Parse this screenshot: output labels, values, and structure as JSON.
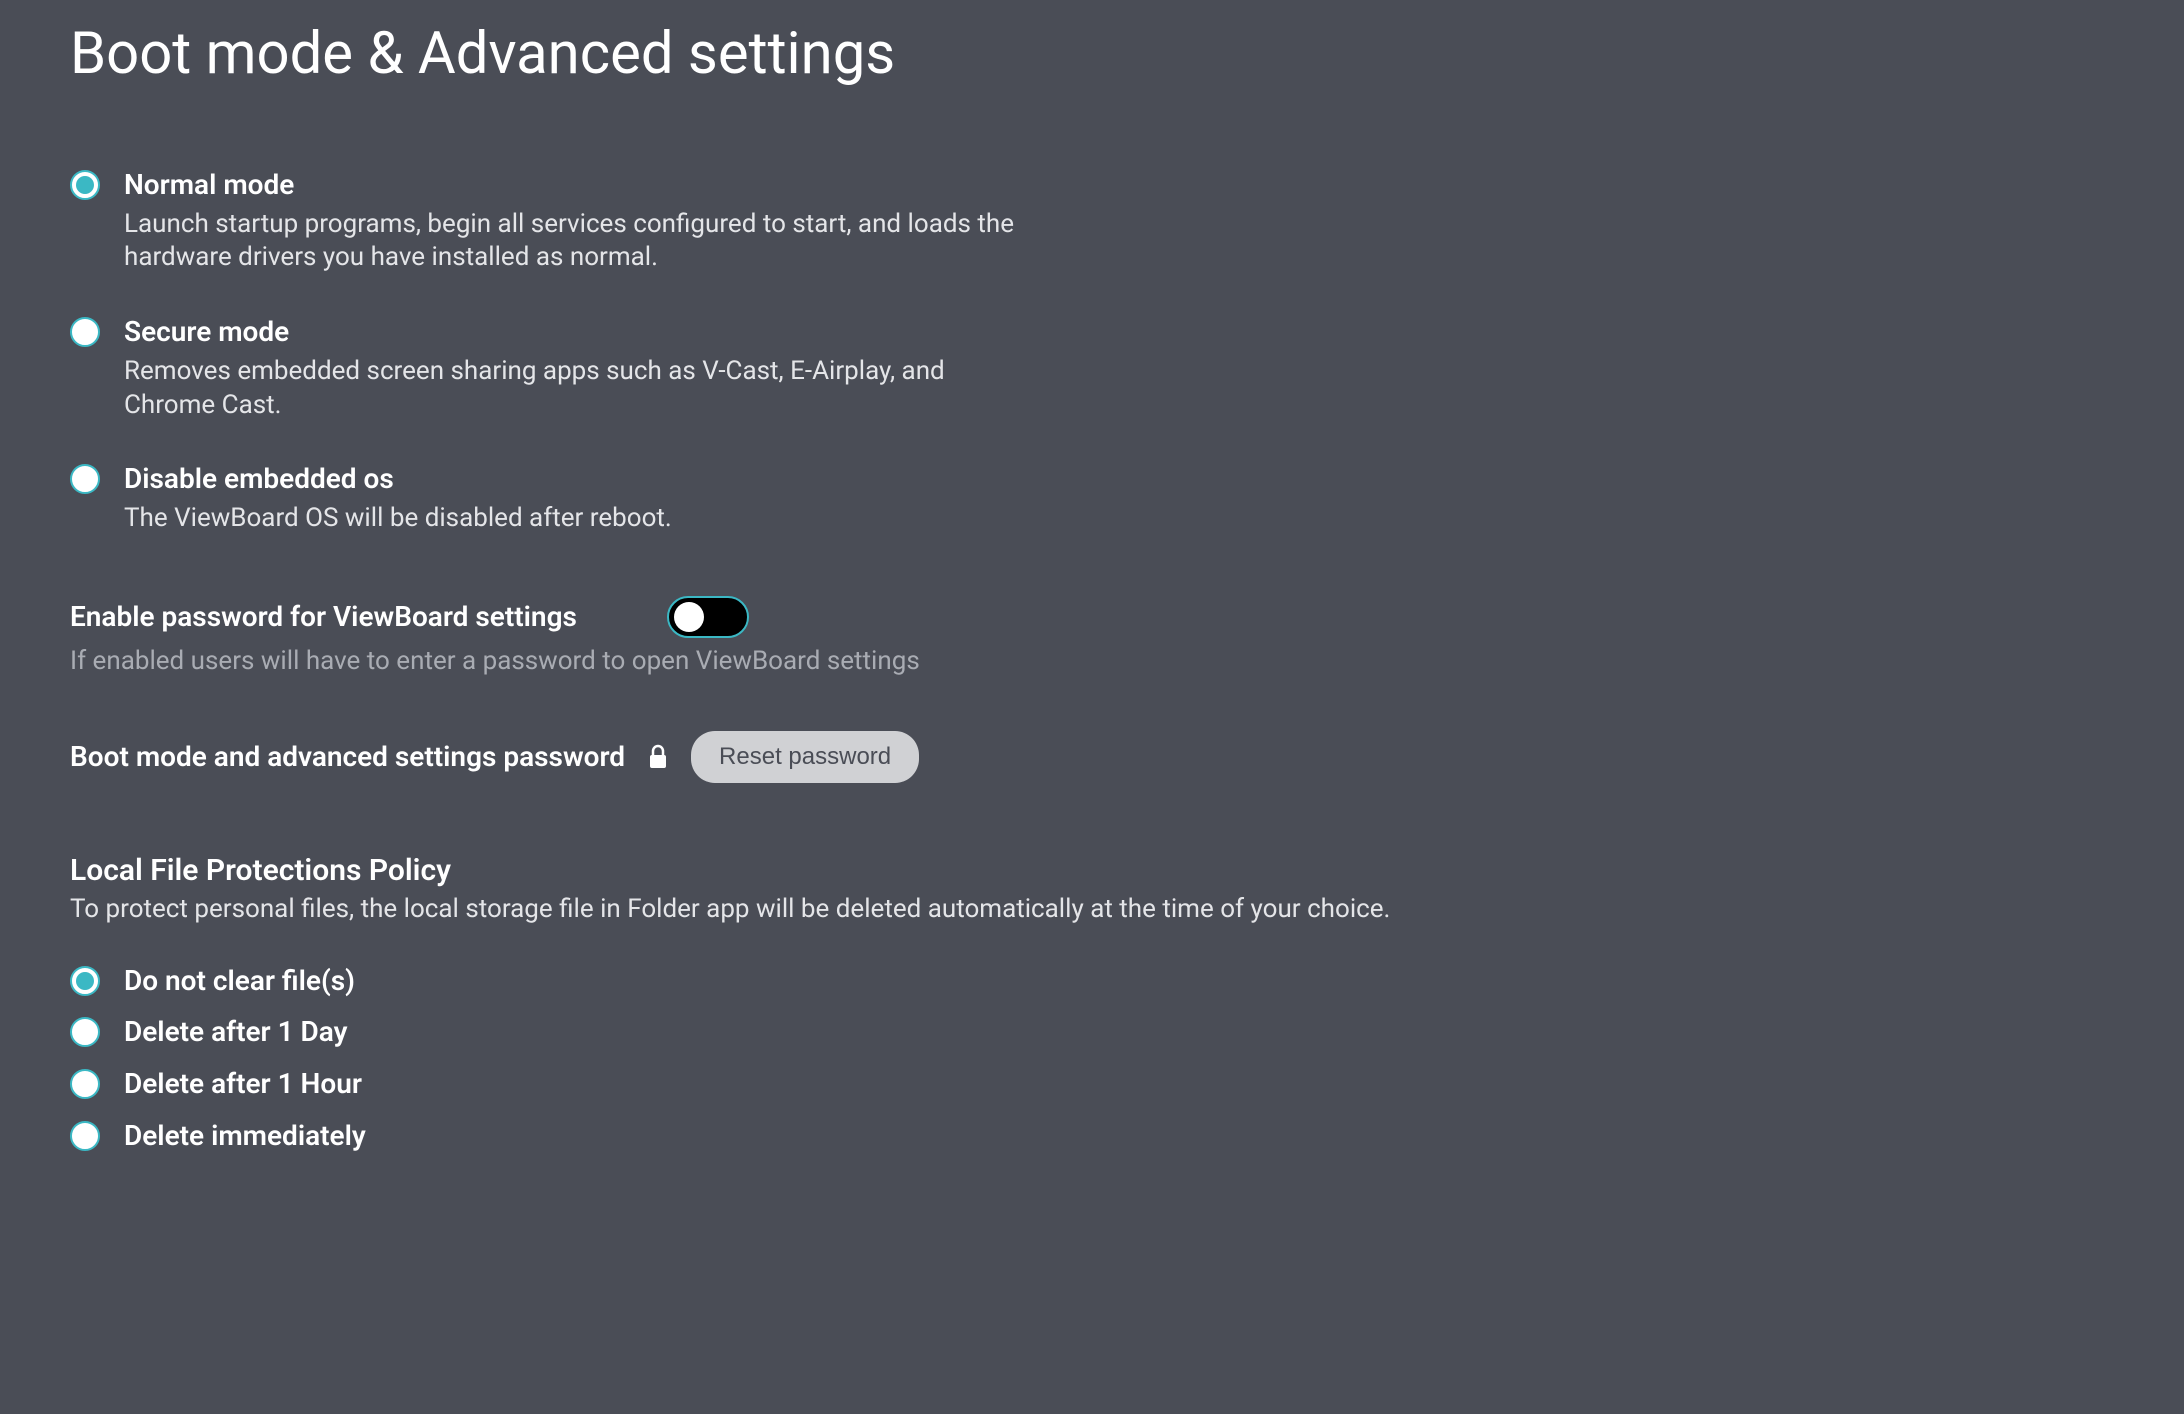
{
  "page": {
    "title": "Boot mode & Advanced settings"
  },
  "bootMode": {
    "options": [
      {
        "label": "Normal mode",
        "description": "Launch startup programs, begin all services configured to start, and loads the hardware drivers you have installed as normal.",
        "selected": true
      },
      {
        "label": "Secure mode",
        "description": "Removes embedded screen sharing apps such as V-Cast, E-Airplay, and Chrome Cast.",
        "selected": false
      },
      {
        "label": "Disable embedded os",
        "description": "The ViewBoard OS will be disabled after reboot.",
        "selected": false
      }
    ]
  },
  "passwordToggle": {
    "label": "Enable password for ViewBoard settings",
    "description": "If enabled users will have to enter a password to open ViewBoard settings",
    "enabled": false
  },
  "passwordReset": {
    "label": "Boot mode and advanced settings password",
    "button": "Reset password"
  },
  "fileProtection": {
    "title": "Local File Protections Policy",
    "description": "To protect personal files, the local storage file in Folder app will be deleted automatically at the time of your choice.",
    "options": [
      {
        "label": "Do not clear file(s)",
        "selected": true
      },
      {
        "label": "Delete after 1 Day",
        "selected": false
      },
      {
        "label": "Delete after 1 Hour",
        "selected": false
      },
      {
        "label": "Delete immediately",
        "selected": false
      }
    ]
  }
}
